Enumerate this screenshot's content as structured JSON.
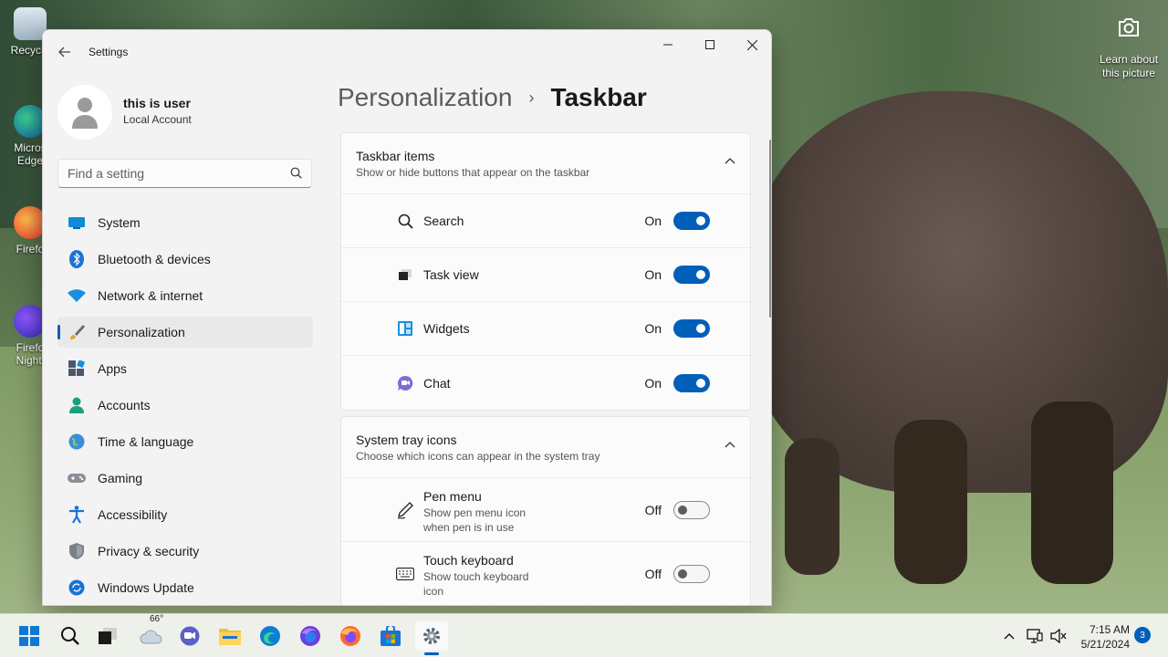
{
  "desktop": {
    "icons": [
      {
        "label": "Recycle"
      },
      {
        "label": "Micros Edge"
      },
      {
        "label": "Firefo"
      },
      {
        "label": "Firefo Nightl"
      }
    ],
    "learn_picture": "Learn about this picture"
  },
  "window": {
    "title": "Settings",
    "controls": {
      "minimize": "—",
      "maximize": "☐",
      "close": "✕"
    }
  },
  "profile": {
    "name": "this is user",
    "account_type": "Local Account"
  },
  "search": {
    "placeholder": "Find a setting"
  },
  "nav": {
    "items": [
      {
        "label": "System",
        "icon": "system-icon"
      },
      {
        "label": "Bluetooth & devices",
        "icon": "bluetooth-icon"
      },
      {
        "label": "Network & internet",
        "icon": "wifi-icon"
      },
      {
        "label": "Personalization",
        "icon": "brush-icon",
        "active": true
      },
      {
        "label": "Apps",
        "icon": "apps-icon"
      },
      {
        "label": "Accounts",
        "icon": "accounts-icon"
      },
      {
        "label": "Time & language",
        "icon": "globe-icon"
      },
      {
        "label": "Gaming",
        "icon": "gamepad-icon"
      },
      {
        "label": "Accessibility",
        "icon": "accessibility-icon"
      },
      {
        "label": "Privacy & security",
        "icon": "shield-icon"
      },
      {
        "label": "Windows Update",
        "icon": "update-icon"
      }
    ]
  },
  "breadcrumb": {
    "parent": "Personalization",
    "separator": "›",
    "current": "Taskbar"
  },
  "taskbar_items": {
    "title": "Taskbar items",
    "subtitle": "Show or hide buttons that appear on the taskbar",
    "rows": [
      {
        "label": "Search",
        "state": "On",
        "icon": "search-icon"
      },
      {
        "label": "Task view",
        "state": "On",
        "icon": "task-view-icon"
      },
      {
        "label": "Widgets",
        "state": "On",
        "icon": "widgets-icon"
      },
      {
        "label": "Chat",
        "state": "On",
        "icon": "chat-icon"
      }
    ]
  },
  "system_tray": {
    "title": "System tray icons",
    "subtitle": "Choose which icons can appear in the system tray",
    "rows": [
      {
        "label": "Pen menu",
        "description": "Show pen menu icon when pen is in use",
        "state": "Off",
        "icon": "pen-icon"
      },
      {
        "label": "Touch keyboard",
        "description": "Show touch keyboard icon",
        "state": "Off",
        "icon": "keyboard-icon"
      }
    ]
  },
  "os_taskbar": {
    "weather_temp": "66°",
    "time": "7:15 AM",
    "date": "5/21/2024",
    "notification_count": "3"
  },
  "colors": {
    "accent": "#005fb8",
    "window_bg": "#f3f3f3",
    "card_bg": "#fbfbfb"
  }
}
